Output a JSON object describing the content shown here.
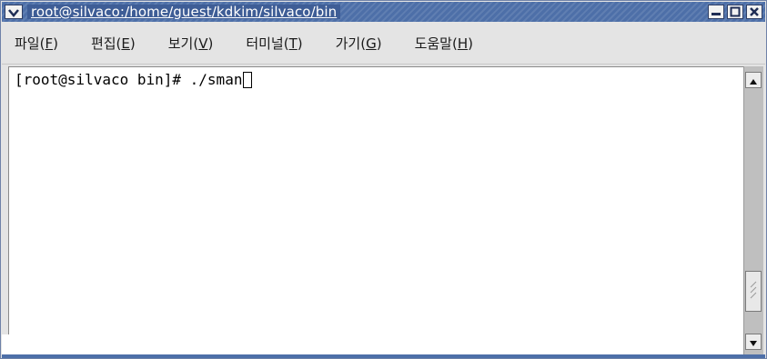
{
  "window": {
    "title": "root@silvaco:/home/guest/kdkim/silvaco/bin",
    "menu_icon": "chevron-down-icon",
    "buttons": [
      "minimize-icon",
      "maximize-icon",
      "close-icon"
    ]
  },
  "menubar": {
    "items": [
      {
        "label_pre": "파일(",
        "mnemonic": "F",
        "label_post": ")"
      },
      {
        "label_pre": "편집(",
        "mnemonic": "E",
        "label_post": ")"
      },
      {
        "label_pre": "보기(",
        "mnemonic": "V",
        "label_post": ")"
      },
      {
        "label_pre": "터미널(",
        "mnemonic": "T",
        "label_post": ")"
      },
      {
        "label_pre": "가기(",
        "mnemonic": "G",
        "label_post": ")"
      },
      {
        "label_pre": "도움말(",
        "mnemonic": "H",
        "label_post": ")"
      }
    ]
  },
  "terminal": {
    "prompt_line": "[root@silvaco bin]# ./sman"
  },
  "scrollbar": {
    "up_icon": "arrow-up-icon",
    "down_icon": "arrow-down-icon"
  },
  "colors": {
    "titlebar": "#4d6fa8",
    "menubar_bg": "#e4e4e4",
    "terminal_bg": "#ffffff"
  }
}
